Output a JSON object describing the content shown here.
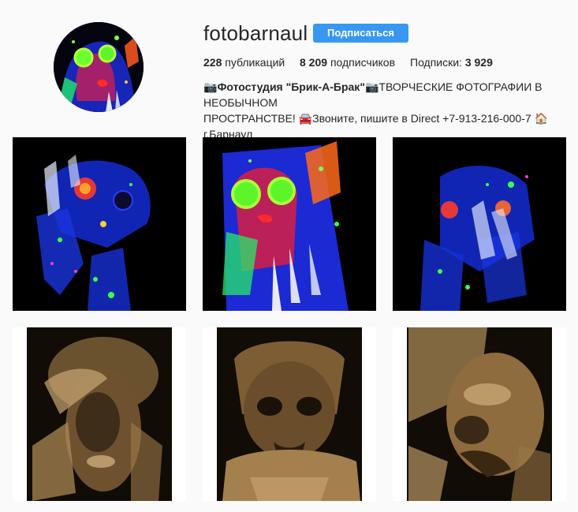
{
  "profile": {
    "username": "fotobarnaul",
    "follow_label": "Подписаться",
    "stats": {
      "posts_count": "228",
      "posts_label": "публикаций",
      "followers_count": "8 209",
      "followers_label": "подписчиков",
      "following_label": "Подписки:",
      "following_count": "3 929"
    },
    "bio": {
      "camera_emoji_1": "📷",
      "studio_name": "Фотостудия \"Брик-А-Брак\"",
      "camera_emoji_2": "📷",
      "line1_rest": "ТВОРЧЕСКИЕ ФОТОГРАФИИ В НЕОБЫЧНОМ",
      "line2_start": "ПРОСТРАНСТВЕ! ",
      "car_emoji": "🚘",
      "contact_text": "Звоните, пишите в Direct +7-913-216-000-7 ",
      "house_emoji": "🏠",
      "city": "г.Барнаул"
    }
  },
  "icons": {
    "avatar": "avatar-neon-portrait",
    "posts": [
      "neon-portrait-photo",
      "neon-portrait-photo",
      "neon-portrait-photo",
      "sepia-portrait-photo",
      "sepia-portrait-photo",
      "sepia-portrait-photo"
    ]
  },
  "colors": {
    "follow_button": "#3897f0",
    "background": "#fafafa",
    "text": "#262626"
  }
}
